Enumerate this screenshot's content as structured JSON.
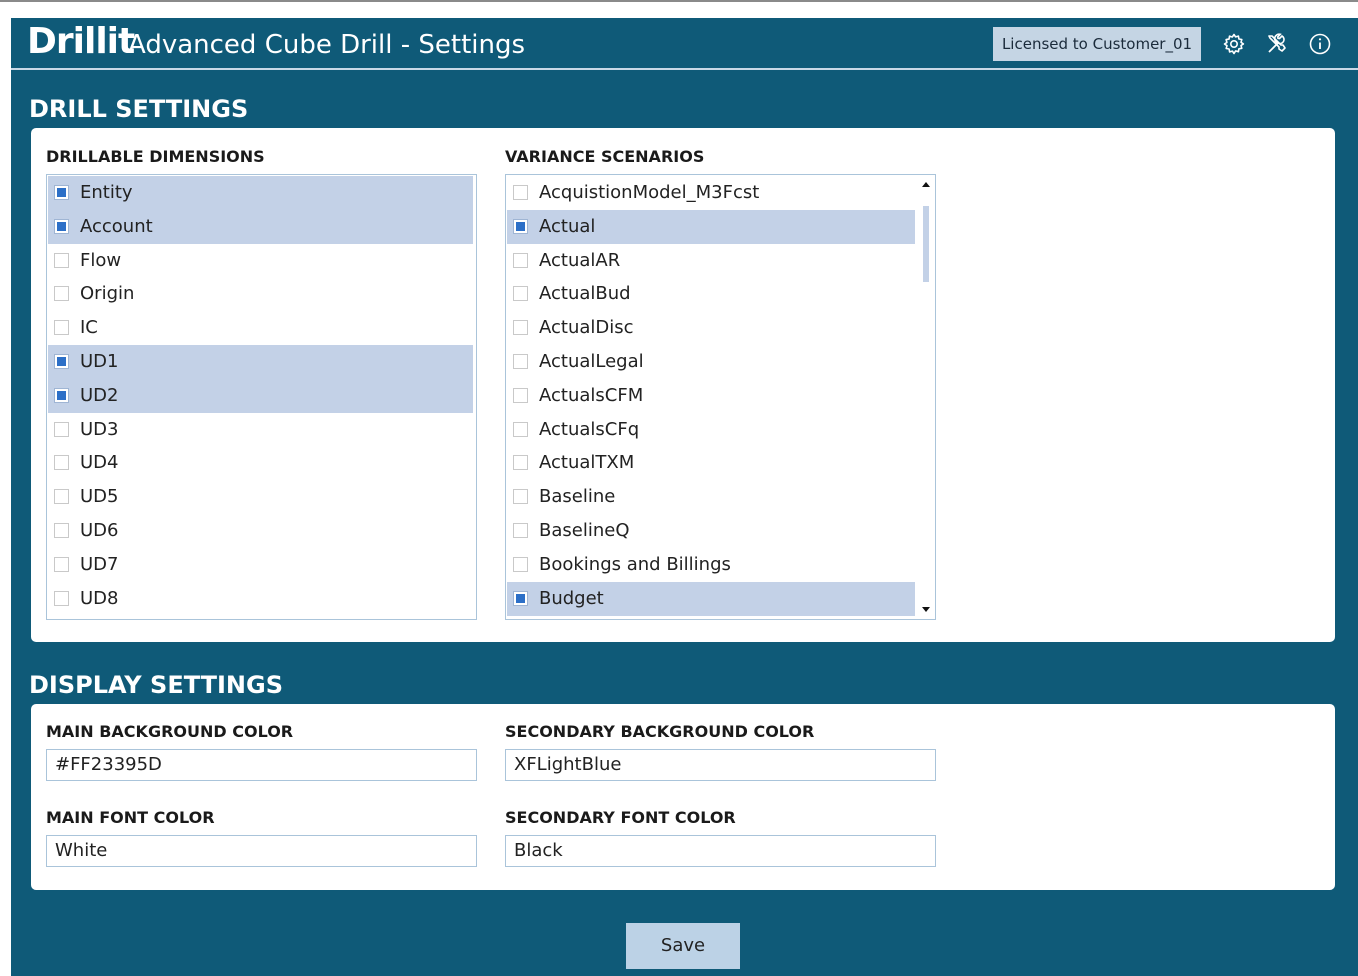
{
  "header": {
    "logo": "Drillit",
    "title": "Advanced Cube Drill - Settings",
    "license": "Licensed to Customer_01",
    "icons": [
      "gear-icon",
      "tools-icon",
      "info-icon"
    ]
  },
  "drill_settings": {
    "title": "DRILL SETTINGS",
    "dimensions_label": "DRILLABLE DIMENSIONS",
    "dimensions": [
      {
        "label": "Entity",
        "checked": true
      },
      {
        "label": "Account",
        "checked": true
      },
      {
        "label": "Flow",
        "checked": false
      },
      {
        "label": "Origin",
        "checked": false
      },
      {
        "label": "IC",
        "checked": false
      },
      {
        "label": "UD1",
        "checked": true
      },
      {
        "label": "UD2",
        "checked": true
      },
      {
        "label": "UD3",
        "checked": false
      },
      {
        "label": "UD4",
        "checked": false
      },
      {
        "label": "UD5",
        "checked": false
      },
      {
        "label": "UD6",
        "checked": false
      },
      {
        "label": "UD7",
        "checked": false
      },
      {
        "label": "UD8",
        "checked": false
      }
    ],
    "scenarios_label": "VARIANCE SCENARIOS",
    "scenarios": [
      {
        "label": "AcquistionModel_M3Fcst",
        "checked": false
      },
      {
        "label": "Actual",
        "checked": true
      },
      {
        "label": "ActualAR",
        "checked": false
      },
      {
        "label": "ActualBud",
        "checked": false
      },
      {
        "label": "ActualDisc",
        "checked": false
      },
      {
        "label": "ActualLegal",
        "checked": false
      },
      {
        "label": "ActualsCFM",
        "checked": false
      },
      {
        "label": "ActualsCFq",
        "checked": false
      },
      {
        "label": "ActualTXM",
        "checked": false
      },
      {
        "label": "Baseline",
        "checked": false
      },
      {
        "label": "BaselineQ",
        "checked": false
      },
      {
        "label": "Bookings and Billings",
        "checked": false
      },
      {
        "label": "Budget",
        "checked": true
      }
    ]
  },
  "display_settings": {
    "title": "DISPLAY SETTINGS",
    "main_bg_label": "MAIN BACKGROUND COLOR",
    "main_bg_value": "#FF23395D",
    "secondary_bg_label": "SECONDARY BACKGROUND COLOR",
    "secondary_bg_value": "XFLightBlue",
    "main_font_label": "MAIN FONT COLOR",
    "main_font_value": "White",
    "secondary_font_label": "SECONDARY FONT COLOR",
    "secondary_font_value": "Black"
  },
  "actions": {
    "save_label": "Save"
  },
  "colors": {
    "app_bg": "#0f5a78",
    "selected_row": "#c3d1e7",
    "checkbox_fill": "#2c6fc7",
    "save_button": "#bcd2e6"
  }
}
